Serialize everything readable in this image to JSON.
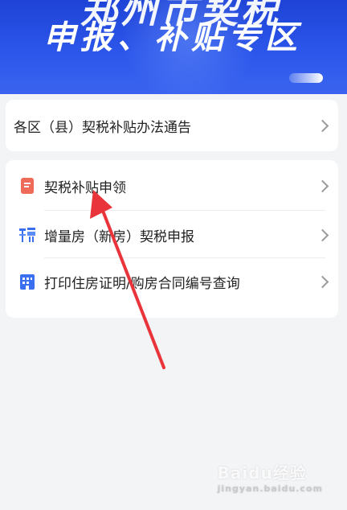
{
  "banner": {
    "title_top": "郑州市契税",
    "title": "申报、补贴专区"
  },
  "card1": {
    "item": {
      "label": "各区（县）契税补贴办法通告"
    }
  },
  "card2": {
    "items": [
      {
        "label": "契税补贴申领",
        "icon": "document-icon",
        "icon_color": "#f06a5a"
      },
      {
        "label": "增量房（新房）契税申报",
        "icon": "tax-icon",
        "icon_color": "#3a6ff0"
      },
      {
        "label": "打印住房证明/购房合同编号查询",
        "icon": "building-icon",
        "icon_color": "#3a6ff0"
      }
    ]
  },
  "annotation": {
    "arrow_color": "#e8343a"
  },
  "watermark": {
    "text": "Baidu经验",
    "sub": "jingyan.baidu.com"
  }
}
